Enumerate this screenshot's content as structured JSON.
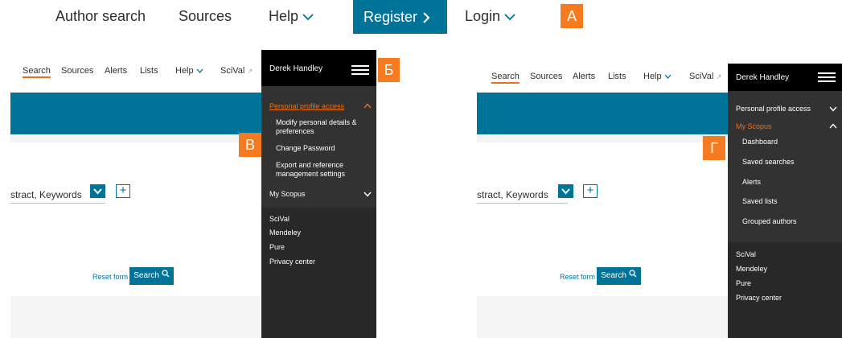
{
  "topnav": {
    "author_search": "Author search",
    "sources": "Sources",
    "help": "Help",
    "register": "Register",
    "login": "Login"
  },
  "markers": {
    "a": "А",
    "b": "Б",
    "v": "В",
    "g": "Г"
  },
  "panel_left": {
    "nav": {
      "search": "Search",
      "sources": "Sources",
      "alerts": "Alerts",
      "lists": "Lists",
      "help": "Help",
      "scival": "SciVal"
    },
    "keywords": "stract, Keywords",
    "reset": "Reset form",
    "search_button": "Search"
  },
  "panel_right": {
    "nav": {
      "search": "Search",
      "sources": "Sources",
      "alerts": "Alerts",
      "lists": "Lists",
      "help": "Help",
      "scival": "SciVal"
    },
    "keywords": "stract, Keywords",
    "reset": "Reset form",
    "search_button": "Search"
  },
  "drawer_left": {
    "user": "Derek Handley",
    "profile": "Personal profile access",
    "items": [
      "Modify personal details &",
      "preferences",
      "Change Password",
      "Export and reference",
      "management settings"
    ],
    "my_scopus": "My Scopus",
    "links": [
      "SciVal",
      "Mendeley",
      "Pure",
      "Privacy center"
    ]
  },
  "drawer_right": {
    "user": "Derek Handley",
    "profile": "Personal profile access",
    "my_scopus": "My Scopus",
    "items": [
      "Dashboard",
      "Saved searches",
      "Alerts",
      "Saved lists",
      "Grouped authors"
    ],
    "links": [
      "SciVal",
      "Mendeley",
      "Pure",
      "Privacy center"
    ]
  },
  "colors": {
    "brand": "#007398",
    "accent": "#f47b20",
    "drawer": "#323232"
  }
}
